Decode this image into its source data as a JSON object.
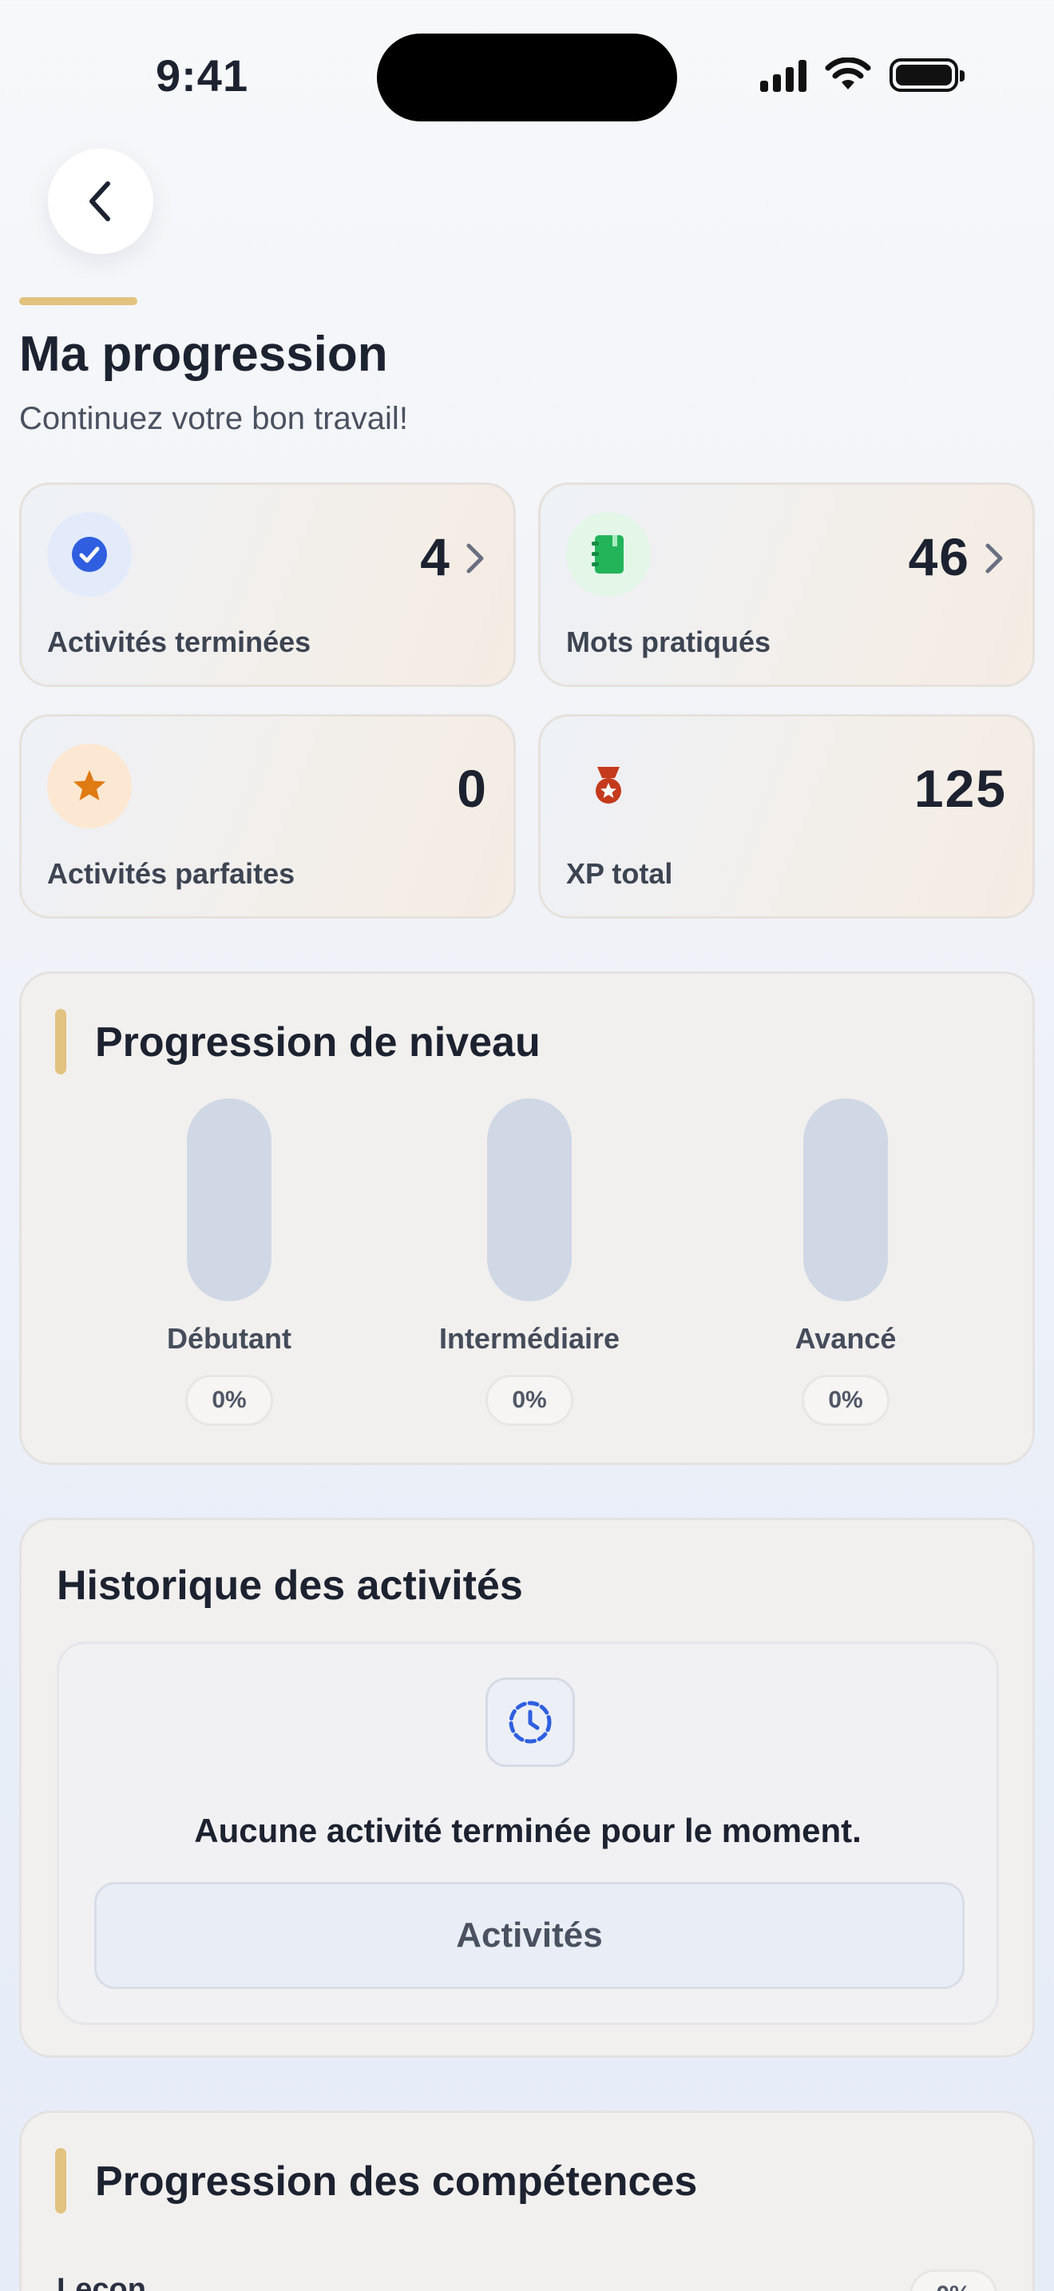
{
  "status_bar": {
    "time": "9:41"
  },
  "header": {
    "title": "Ma progression",
    "subtitle": "Continuez votre bon travail!"
  },
  "stats": [
    {
      "value": "4",
      "label": "Activités terminées",
      "icon": "check-circle-icon",
      "color": "#2f5fe0",
      "has_chevron": true
    },
    {
      "value": "46",
      "label": "Mots pratiqués",
      "icon": "notebook-icon",
      "color": "#23b45a",
      "has_chevron": true
    },
    {
      "value": "0",
      "label": "Activités parfaites",
      "icon": "star-icon",
      "color": "#e07a12",
      "has_chevron": false
    },
    {
      "value": "125",
      "label": "XP total",
      "icon": "medal-icon",
      "color": "#c43a1c",
      "has_chevron": false
    }
  ],
  "level_progress": {
    "title": "Progression de niveau",
    "levels": [
      {
        "label": "Débutant",
        "percent": "0%",
        "value": 0
      },
      {
        "label": "Intermédiaire",
        "percent": "0%",
        "value": 0
      },
      {
        "label": "Avancé",
        "percent": "0%",
        "value": 0
      }
    ]
  },
  "history": {
    "title": "Historique des activités",
    "empty_text": "Aucune activité terminée pour le moment.",
    "button_label": "Activités",
    "icon": "clock-history-icon"
  },
  "skills": {
    "title": "Progression des compétences",
    "items": [
      {
        "label": "Leçon",
        "percent": "0%"
      }
    ]
  },
  "colors": {
    "accent": "#e2c27f",
    "primary": "#2f5fe0"
  }
}
